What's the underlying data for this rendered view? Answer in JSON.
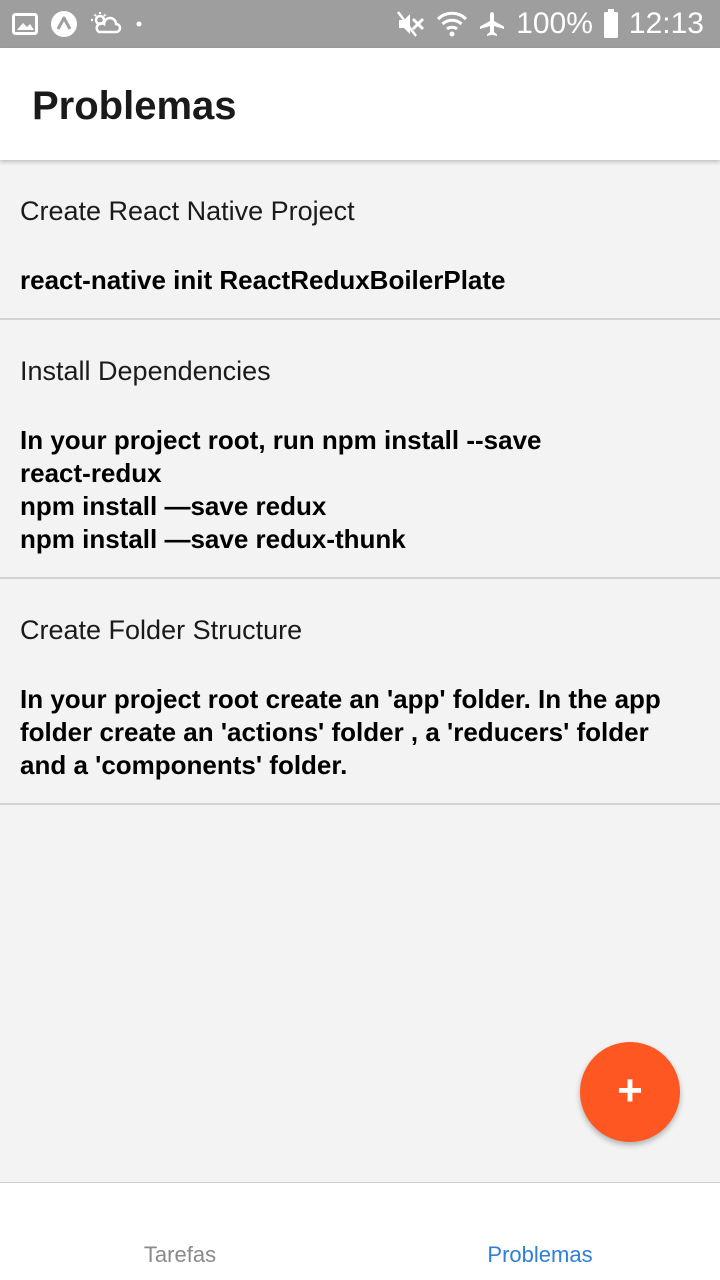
{
  "status_bar": {
    "battery_percent": "100%",
    "time": "12:13",
    "icons": [
      "image-icon",
      "app-a-icon",
      "weather-icon",
      "dot-icon",
      "mute-icon",
      "wifi-icon",
      "airplane-icon",
      "battery-icon"
    ]
  },
  "header": {
    "title": "Problemas"
  },
  "problems": [
    {
      "title": "Create React Native Project",
      "body": "react-native init ReactReduxBoilerPlate"
    },
    {
      "title": "Install Dependencies",
      "body": "In your project root, run npm install --save\nreact-redux\nnpm install —save redux\nnpm install —save redux-thunk"
    },
    {
      "title": "Create Folder Structure",
      "body": "In your project root create an 'app' folder. In the app\nfolder create an 'actions' folder , a 'reducers' folder\nand a 'components' folder."
    }
  ],
  "fab": {
    "label": "+",
    "color": "#ff5722"
  },
  "tabs": [
    {
      "label": "Tarefas",
      "active": false
    },
    {
      "label": "Problemas",
      "active": true
    }
  ],
  "colors": {
    "accent": "#2f7fd6",
    "status_bar": "#9e9e9e"
  }
}
